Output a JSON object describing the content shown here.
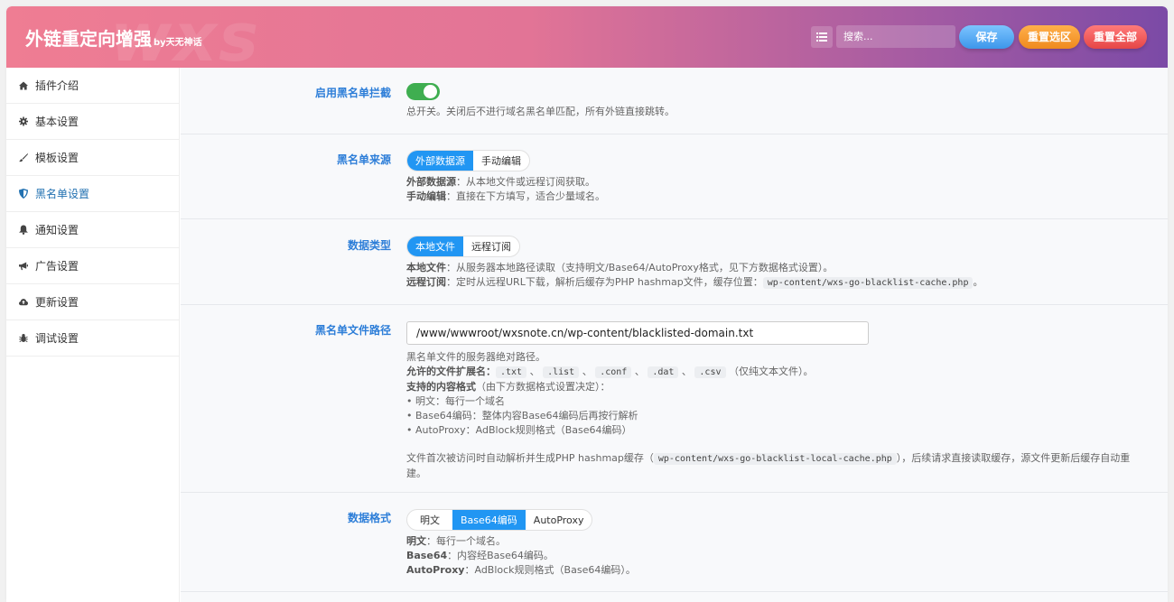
{
  "header": {
    "title": "外链重定向增强",
    "title_suffix": "by天无神话",
    "watermark": "wxs",
    "search_placeholder": "搜索...",
    "save_label": "保存",
    "reset_selected_label": "重置选区",
    "reset_all_label": "重置全部"
  },
  "sidebar": {
    "items": [
      {
        "label": "插件介绍",
        "icon": "home-icon"
      },
      {
        "label": "基本设置",
        "icon": "gear-icon"
      },
      {
        "label": "模板设置",
        "icon": "brush-icon"
      },
      {
        "label": "黑名单设置",
        "icon": "shield-icon",
        "active": true
      },
      {
        "label": "通知设置",
        "icon": "bell-icon"
      },
      {
        "label": "广告设置",
        "icon": "bullhorn-icon"
      },
      {
        "label": "更新设置",
        "icon": "cloud-upload-icon"
      },
      {
        "label": "调试设置",
        "icon": "bug-icon"
      }
    ]
  },
  "sections": {
    "enable": {
      "label": "启用黑名单拦截",
      "desc": "总开关。关闭后不进行域名黑名单匹配，所有外链直接跳转。"
    },
    "source": {
      "label": "黑名单来源",
      "options": [
        "外部数据源",
        "手动编辑"
      ],
      "selected": "外部数据源",
      "desc1_key": "外部数据源",
      "desc1": "：从本地文件或远程订阅获取。",
      "desc2_key": "手动编辑",
      "desc2": "：直接在下方填写，适合少量域名。"
    },
    "data_type": {
      "label": "数据类型",
      "options": [
        "本地文件",
        "远程订阅"
      ],
      "selected": "本地文件",
      "desc1_key": "本地文件",
      "desc1": "：从服务器本地路径读取（支持明文/Base64/AutoProxy格式，见下方数据格式设置）。",
      "desc2_key": "远程订阅",
      "desc2": "：定时从远程URL下载，解析后缓存为PHP hashmap文件，缓存位置：",
      "desc2_code": "wp-content/wxs-go-blacklist-cache.php",
      "desc2_end": "。"
    },
    "file_path": {
      "label": "黑名单文件路径",
      "value": "/www/wwwroot/wxsnote.cn/wp-content/blacklisted-domain.txt",
      "line1": "黑名单文件的服务器绝对路径。",
      "ext_key": "允许的文件扩展名：",
      "extensions": [
        ".txt",
        ".list",
        ".conf",
        ".dat",
        ".csv"
      ],
      "sep": "、",
      "ext_end": "（仅纯文本文件）。",
      "formats_key": "支持的内容格式",
      "formats_note": "（由下方数据格式设置决定）：",
      "bullet1": "• 明文：每行一个域名",
      "bullet2": "• Base64编码：整体内容Base64编码后再按行解析",
      "bullet3": "• AutoProxy：AdBlock规则格式（Base64编码）",
      "cache_pre": "文件首次被访问时自动解析并生成PHP hashmap缓存（",
      "cache_code": "wp-content/wxs-go-blacklist-local-cache.php",
      "cache_post": "），后续请求直接读取缓存，源文件更新后缓存自动重建。"
    },
    "data_format": {
      "label": "数据格式",
      "options": [
        "明文",
        "Base64编码",
        "AutoProxy"
      ],
      "selected": "Base64编码",
      "desc1_key": "明文",
      "desc1": "：每行一个域名。",
      "desc2_key": "Base64",
      "desc2": "：内容经Base64编码。",
      "desc3_key": "AutoProxy",
      "desc3": "：AdBlock规则格式（Base64编码）。"
    }
  },
  "colors": {
    "accent": "#2196f3",
    "label": "#2d7ed8",
    "toggle_on": "#3fae50"
  }
}
